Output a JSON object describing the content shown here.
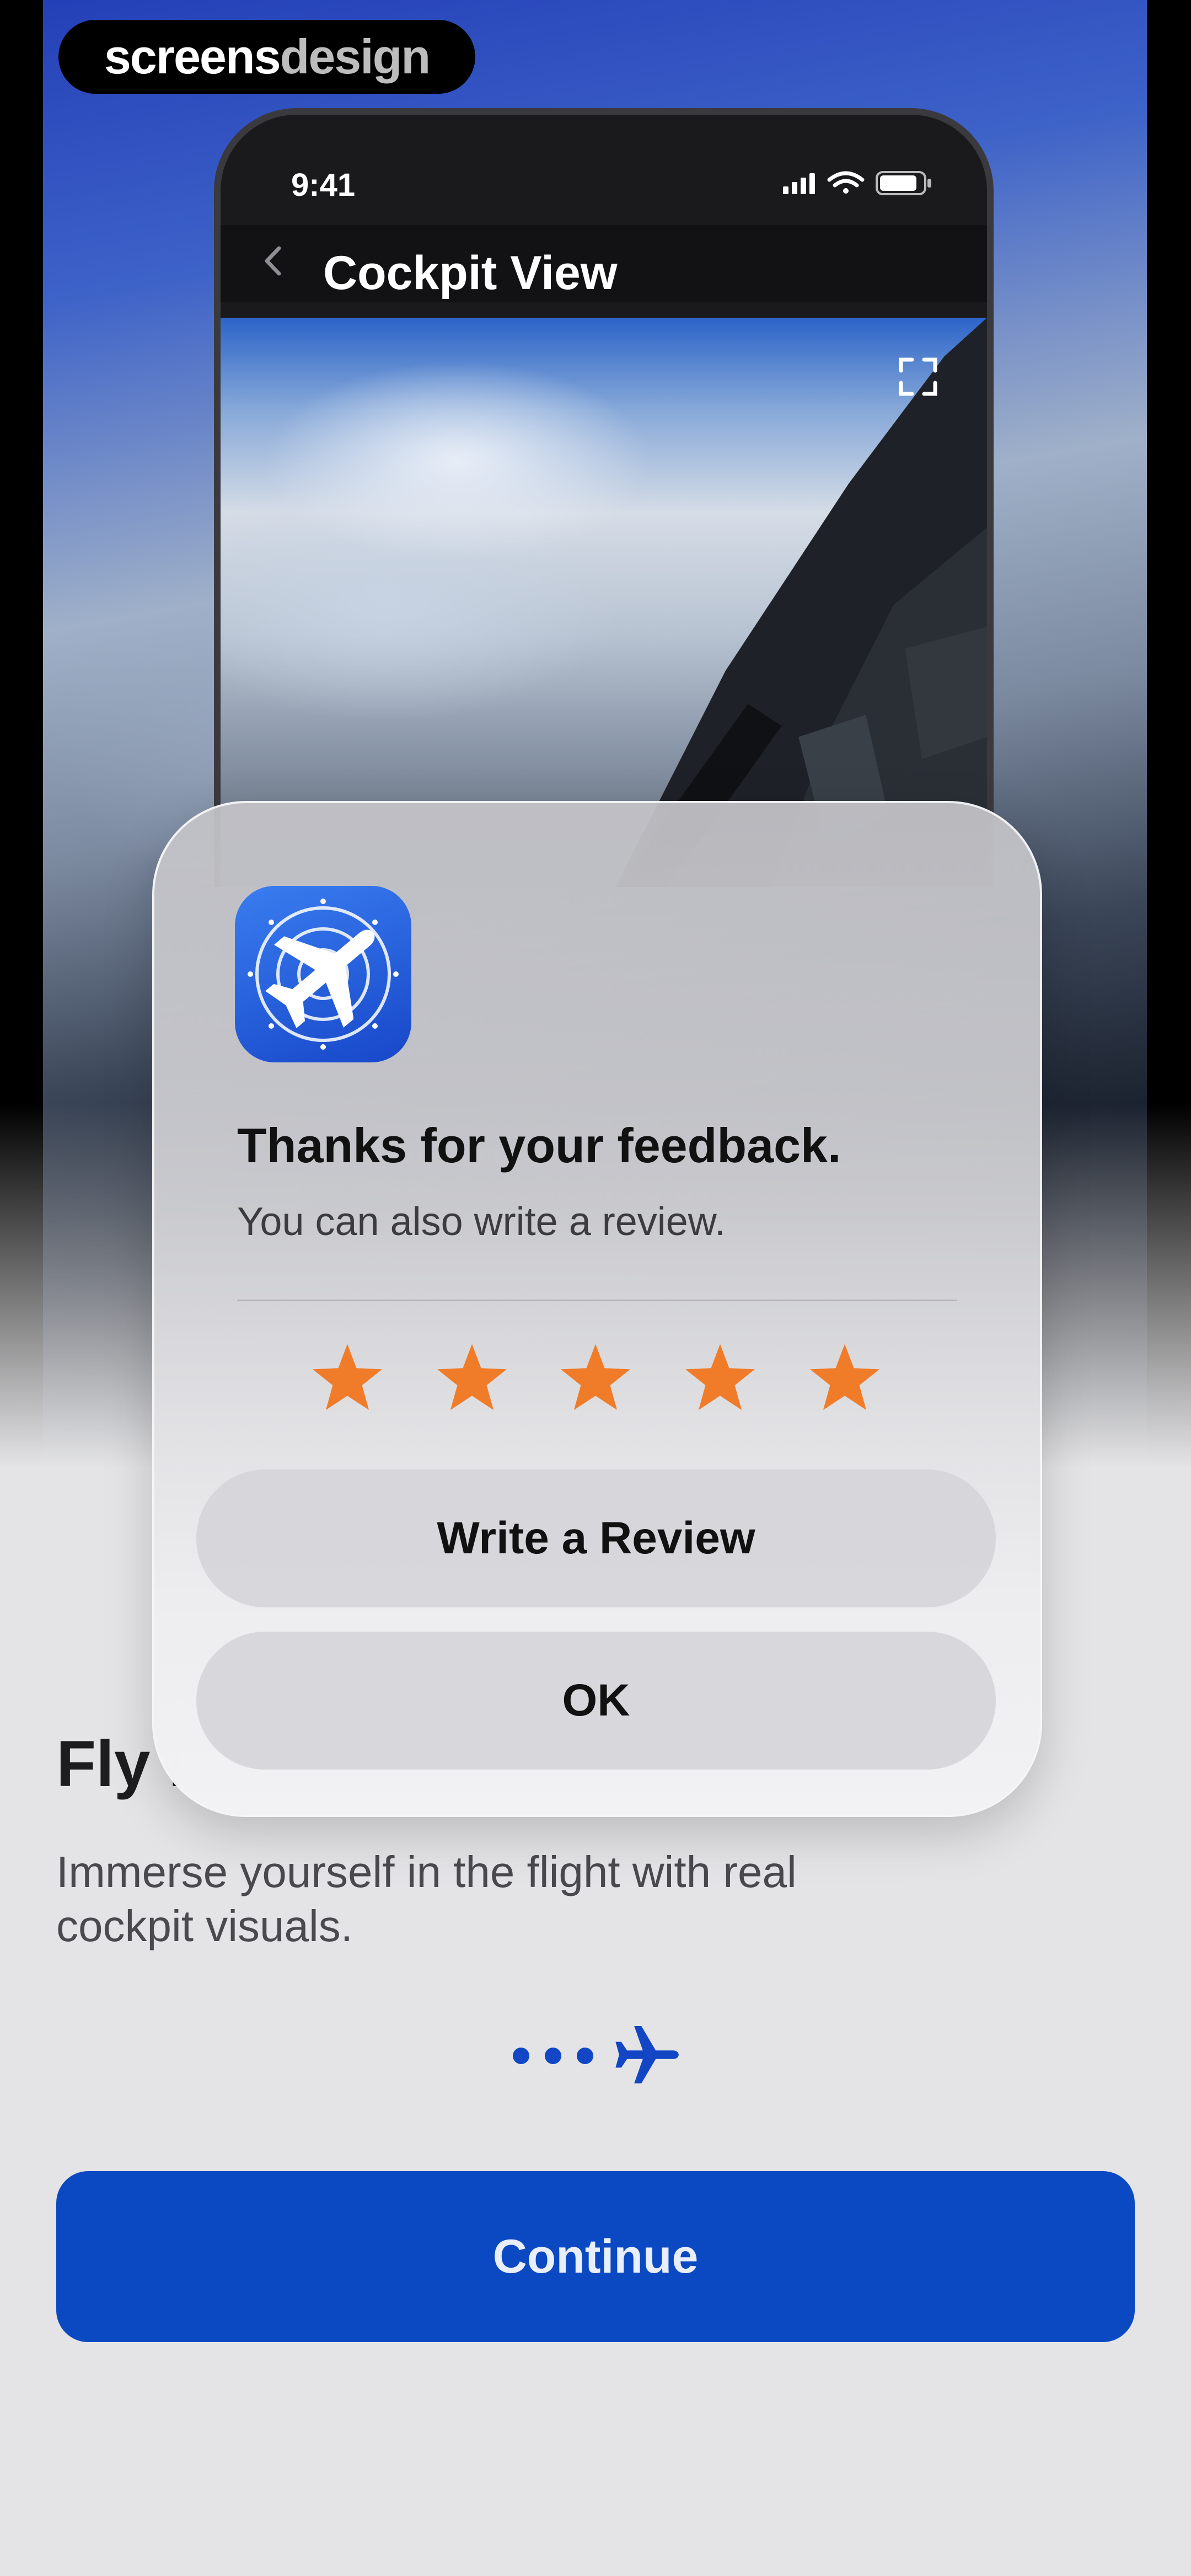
{
  "watermark": {
    "part1": "screens",
    "part2": "design"
  },
  "inner_phone": {
    "time": "9:41",
    "nav_title": "Cockpit View",
    "icons": [
      "chevron-left-icon",
      "signal-icon",
      "wifi-icon",
      "battery-icon",
      "fullscreen-icon"
    ]
  },
  "onboarding": {
    "title": "Fly l",
    "description": "Immerse yourself in the flight with real cockpit visuals.",
    "continue_label": "Continue",
    "pager": {
      "dots": 3,
      "active_icon": "airplane-icon"
    }
  },
  "rating_dialog": {
    "app_icon": "airplane-radar-icon",
    "title": "Thanks for your feedback.",
    "message": "You can also write a review.",
    "rating": 5,
    "max_rating": 5,
    "write_review_label": "Write a Review",
    "ok_label": "OK"
  },
  "colors": {
    "accent_blue": "#0b49c2",
    "star_orange": "#f07c2a",
    "background": "#e4e4e6"
  }
}
